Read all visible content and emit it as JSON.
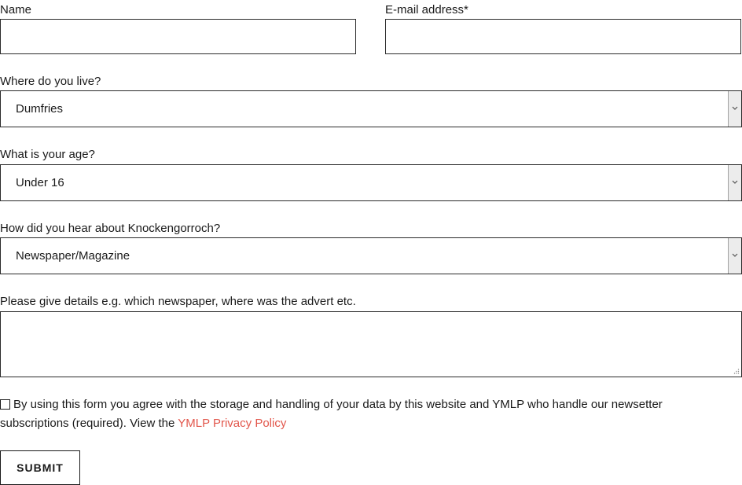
{
  "form": {
    "name": {
      "label": "Name",
      "value": ""
    },
    "email": {
      "label": "E-mail address*",
      "value": ""
    },
    "location": {
      "label": "Where do you live?",
      "selected": "Dumfries"
    },
    "age": {
      "label": "What is your age?",
      "selected": "Under 16"
    },
    "source": {
      "label": "How did you hear about Knockengorroch?",
      "selected": "Newspaper/Magazine"
    },
    "details": {
      "label": "Please give details e.g. which newspaper, where was the advert etc.",
      "value": ""
    },
    "consent": {
      "text_line1": "By using this form you agree with the storage and handling of your data by this website and YMLP who handle our newsetter",
      "text_line2": "subscriptions (required). View the ",
      "link_text": "YMLP Privacy Policy",
      "checked": false
    },
    "submit_label": "SUBMIT"
  },
  "colors": {
    "text": "#1a1a1a",
    "border": "#2b2b2b",
    "link": "#e2574c",
    "arrow_bg": "#ececec"
  }
}
